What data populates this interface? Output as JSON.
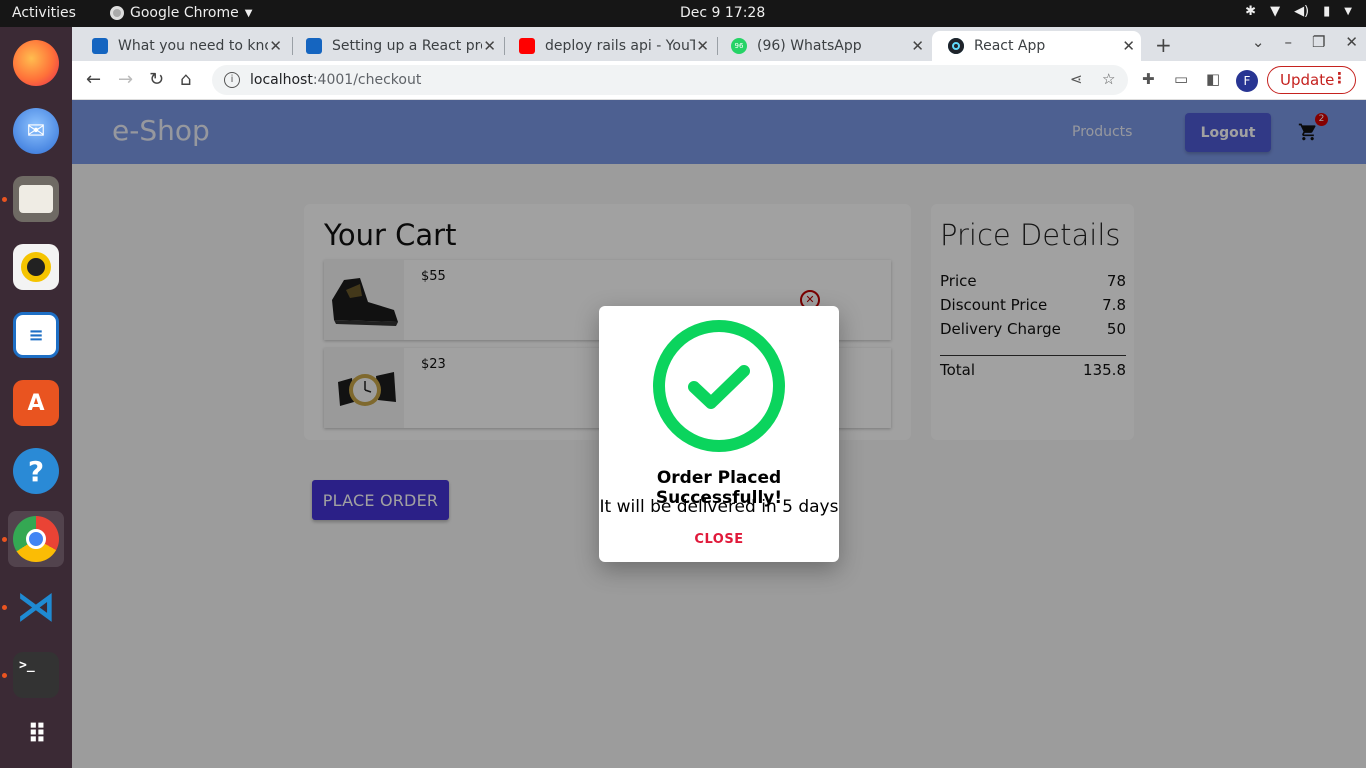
{
  "os": {
    "activities": "Activities",
    "app_menu": "Google Chrome",
    "clock": "Dec 9  17:28",
    "dock": [
      {
        "name": "firefox",
        "color": "#ff7139"
      },
      {
        "name": "thunderbird",
        "color": "#2f6fd6"
      },
      {
        "name": "files",
        "color": "#e8e4d8"
      },
      {
        "name": "rhythmbox",
        "color": "#f5c400"
      },
      {
        "name": "writer",
        "color": "#1e6fc5"
      },
      {
        "name": "software",
        "color": "#e95420"
      },
      {
        "name": "help",
        "color": "#2a8ad6"
      },
      {
        "name": "chrome",
        "color": "#34a853"
      },
      {
        "name": "vscode",
        "color": "#1f8ad2"
      },
      {
        "name": "terminal",
        "color": "#333333"
      },
      {
        "name": "app-grid",
        "color": "#ffffff"
      }
    ]
  },
  "browser": {
    "tabs": [
      {
        "label": "What you need to know"
      },
      {
        "label": "Setting up a React project"
      },
      {
        "label": "deploy rails api - YouTube"
      },
      {
        "label": "(96) WhatsApp",
        "badge": "96"
      },
      {
        "label": "React App"
      }
    ],
    "url_host": "localhost",
    "url_path": ":4001/checkout",
    "profile_initial": "F",
    "update_label": "Update"
  },
  "app": {
    "brand": "e-Shop",
    "nav_products": "Products",
    "logout_label": "Logout",
    "cart_count": "2",
    "cart_title": "Your Cart",
    "items": [
      {
        "price": "$55",
        "image": "sneaker"
      },
      {
        "price": "$23",
        "image": "watch"
      }
    ],
    "price_details": {
      "title": "Price Details",
      "rows": [
        {
          "label": "Price",
          "value": "78"
        },
        {
          "label": "Discount Price",
          "value": "7.8"
        },
        {
          "label": "Delivery Charge",
          "value": "50"
        }
      ],
      "total_label": "Total",
      "total_value": "135.8"
    },
    "place_order_label": "PLACE ORDER",
    "dialog": {
      "title": "Order Placed Successfully!",
      "message": "It will be delivered in 5 days",
      "close_label": "CLOSE"
    }
  }
}
